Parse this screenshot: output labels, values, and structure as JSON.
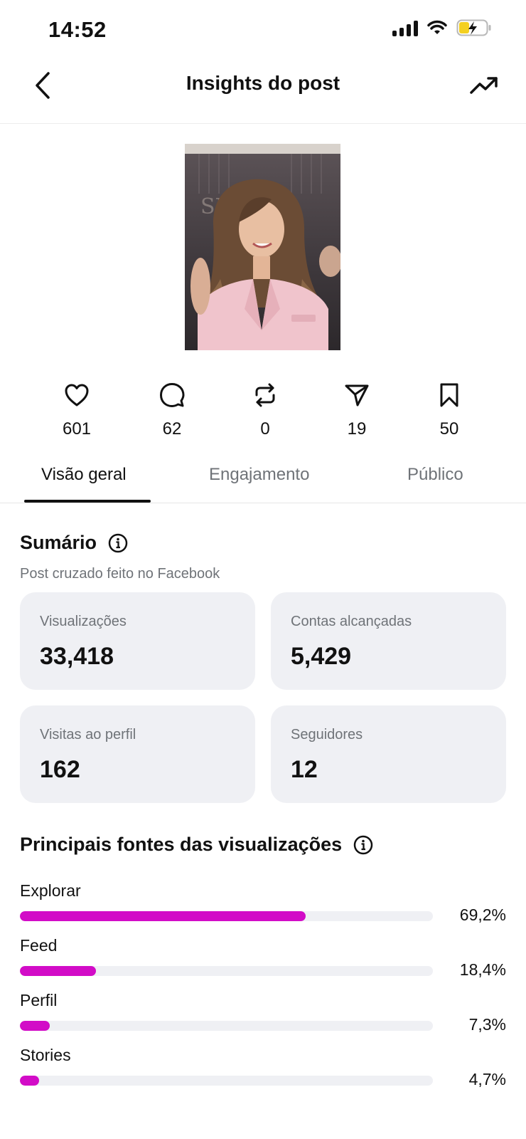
{
  "status_bar": {
    "time": "14:52"
  },
  "header": {
    "title": "Insights do post"
  },
  "metrics": [
    {
      "icon": "heart-icon",
      "value": "601"
    },
    {
      "icon": "comment-icon",
      "value": "62"
    },
    {
      "icon": "repost-icon",
      "value": "0"
    },
    {
      "icon": "share-icon",
      "value": "19"
    },
    {
      "icon": "bookmark-icon",
      "value": "50"
    }
  ],
  "tabs": [
    {
      "label": "Visão geral",
      "active": true
    },
    {
      "label": "Engajamento",
      "active": false
    },
    {
      "label": "Público",
      "active": false
    }
  ],
  "summary": {
    "title": "Sumário",
    "subtitle": "Post cruzado feito no Facebook",
    "cards": [
      {
        "label": "Visualizações",
        "value": "33,418"
      },
      {
        "label": "Contas alcançadas",
        "value": "5,429"
      },
      {
        "label": "Visitas ao perfil",
        "value": "162"
      },
      {
        "label": "Seguidores",
        "value": "12"
      }
    ]
  },
  "sources": {
    "title": "Principais fontes das visualizações",
    "items": [
      {
        "label": "Explorar",
        "percent_text": "69,2%",
        "percent": 69.2
      },
      {
        "label": "Feed",
        "percent_text": "18,4%",
        "percent": 18.4
      },
      {
        "label": "Perfil",
        "percent_text": "7,3%",
        "percent": 7.3
      },
      {
        "label": "Stories",
        "percent_text": "4,7%",
        "percent": 4.7
      }
    ],
    "bar_color": "#d20cc7"
  }
}
